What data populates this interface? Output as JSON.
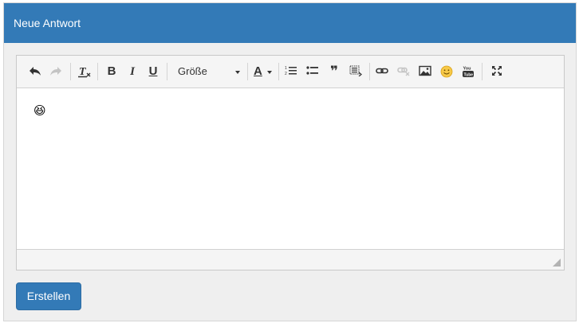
{
  "panel": {
    "title": "Neue Antwort"
  },
  "toolbar": {
    "undo_icon": "undo-icon",
    "redo_icon": "redo-icon",
    "remove_format_icon": "remove-format-icon",
    "bold_label": "B",
    "italic_label": "I",
    "underline_label": "U",
    "size_label": "Größe",
    "font_color_label": "A",
    "quote_label": "❞"
  },
  "editor": {
    "content_emoji": "😆"
  },
  "actions": {
    "submit_label": "Erstellen"
  },
  "colors": {
    "primary": "#337ab7",
    "panel_bg": "#efefef",
    "toolbar_bg": "#f5f5f5"
  }
}
